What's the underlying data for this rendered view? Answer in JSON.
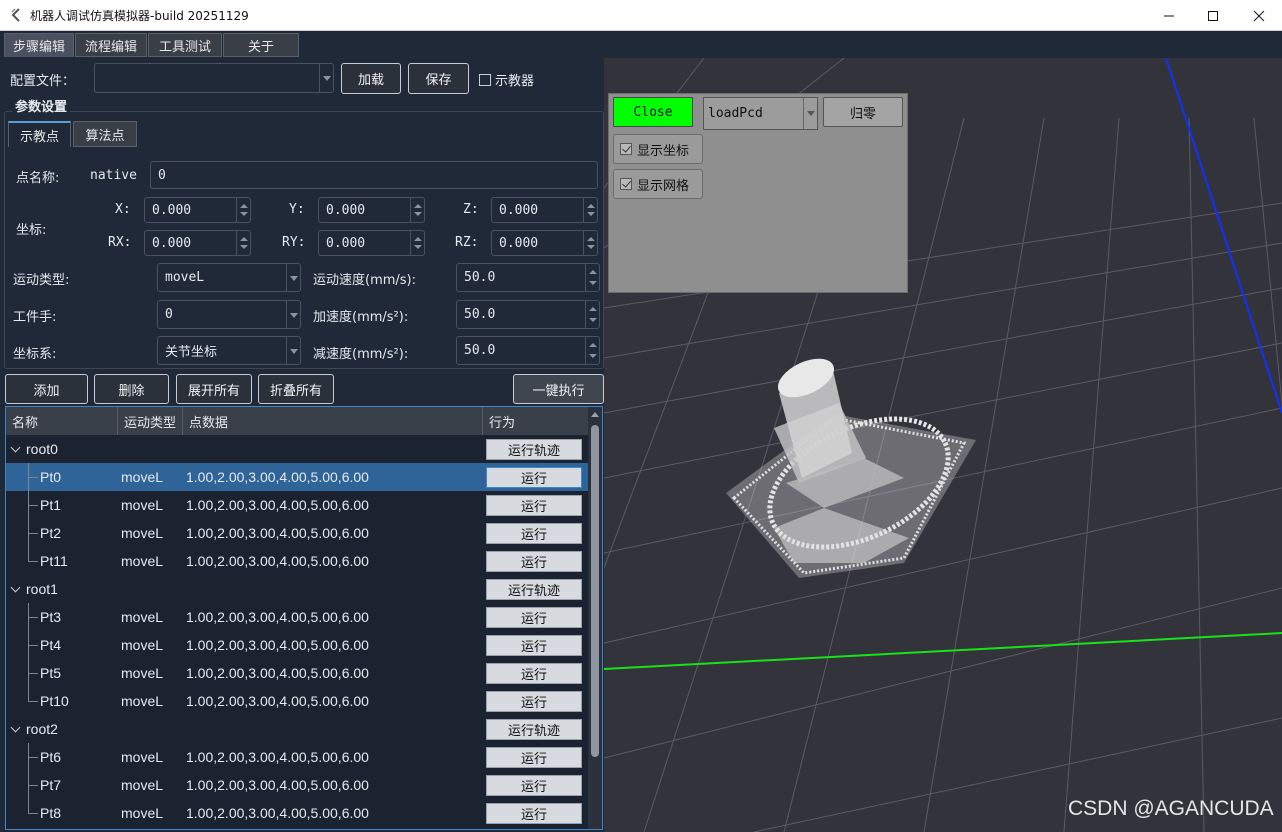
{
  "window": {
    "title": "机器人调试仿真模拟器-build 20251129"
  },
  "main_tabs": [
    "步骤编辑",
    "流程编辑",
    "工具测试",
    "关于"
  ],
  "config": {
    "label": "配置文件：",
    "value": "",
    "load_label": "加载",
    "save_label": "保存",
    "teach_checkbox_label": "示教器"
  },
  "params": {
    "group_title": "参数设置",
    "sub_tabs": [
      "示教点",
      "算法点"
    ],
    "point_name_label": "点名称:",
    "point_name_native": "native",
    "point_name_value": "0",
    "coord_label": "坐标:",
    "coords": [
      {
        "label": "X:",
        "value": "0.000"
      },
      {
        "label": "Y:",
        "value": "0.000"
      },
      {
        "label": "Z:",
        "value": "0.000"
      },
      {
        "label": "RX:",
        "value": "0.000"
      },
      {
        "label": "RY:",
        "value": "0.000"
      },
      {
        "label": "RZ:",
        "value": "0.000"
      }
    ],
    "motion_type_label": "运动类型:",
    "motion_type_value": "moveL",
    "motion_speed_label": "运动速度(mm/s):",
    "motion_speed_value": "50.0",
    "tool_label": "工件手:",
    "tool_value": "0",
    "accel_label": "加速度(mm/s²):",
    "accel_value": "50.0",
    "coord_sys_label": "坐标系:",
    "coord_sys_value": "关节坐标",
    "decel_label": "减速度(mm/s²):",
    "decel_value": "50.0"
  },
  "actions": {
    "add": "添加",
    "delete": "删除",
    "expand_all": "展开所有",
    "collapse_all": "折叠所有",
    "run_all": "一键执行"
  },
  "tree": {
    "headers": [
      "名称",
      "运动类型",
      "点数据",
      "行为"
    ],
    "rows": [
      {
        "name": "root0",
        "type": "",
        "data": "",
        "action": "运行轨迹"
      },
      {
        "name": "Pt0",
        "type": "moveL",
        "data": "1.00,2.00,3.00,4.00,5.00,6.00",
        "action": "运行"
      },
      {
        "name": "Pt1",
        "type": "moveL",
        "data": "1.00,2.00,3.00,4.00,5.00,6.00",
        "action": "运行"
      },
      {
        "name": "Pt2",
        "type": "moveL",
        "data": "1.00,2.00,3.00,4.00,5.00,6.00",
        "action": "运行"
      },
      {
        "name": "Pt11",
        "type": "moveL",
        "data": "1.00,2.00,3.00,4.00,5.00,6.00",
        "action": "运行"
      },
      {
        "name": "root1",
        "type": "",
        "data": "",
        "action": "运行轨迹"
      },
      {
        "name": "Pt3",
        "type": "moveL",
        "data": "1.00,2.00,3.00,4.00,5.00,6.00",
        "action": "运行"
      },
      {
        "name": "Pt4",
        "type": "moveL",
        "data": "1.00,2.00,3.00,4.00,5.00,6.00",
        "action": "运行"
      },
      {
        "name": "Pt5",
        "type": "moveL",
        "data": "1.00,2.00,3.00,4.00,5.00,6.00",
        "action": "运行"
      },
      {
        "name": "Pt10",
        "type": "moveL",
        "data": "1.00,2.00,3.00,4.00,5.00,6.00",
        "action": "运行"
      },
      {
        "name": "root2",
        "type": "",
        "data": "",
        "action": "运行轨迹"
      },
      {
        "name": "Pt6",
        "type": "moveL",
        "data": "1.00,2.00,3.00,4.00,5.00,6.00",
        "action": "运行"
      },
      {
        "name": "Pt7",
        "type": "moveL",
        "data": "1.00,2.00,3.00,4.00,5.00,6.00",
        "action": "运行"
      },
      {
        "name": "Pt8",
        "type": "moveL",
        "data": "1.00,2.00,3.00,4.00,5.00,6.00",
        "action": "运行"
      }
    ]
  },
  "viewer": {
    "close_label": "Close",
    "load_select_value": "loadPcd",
    "reset_label": "归零",
    "show_axes_label": "显示坐标",
    "show_grid_label": "显示网格",
    "watermark": "CSDN @AGANCUDA",
    "close_color": "#00ff00"
  }
}
